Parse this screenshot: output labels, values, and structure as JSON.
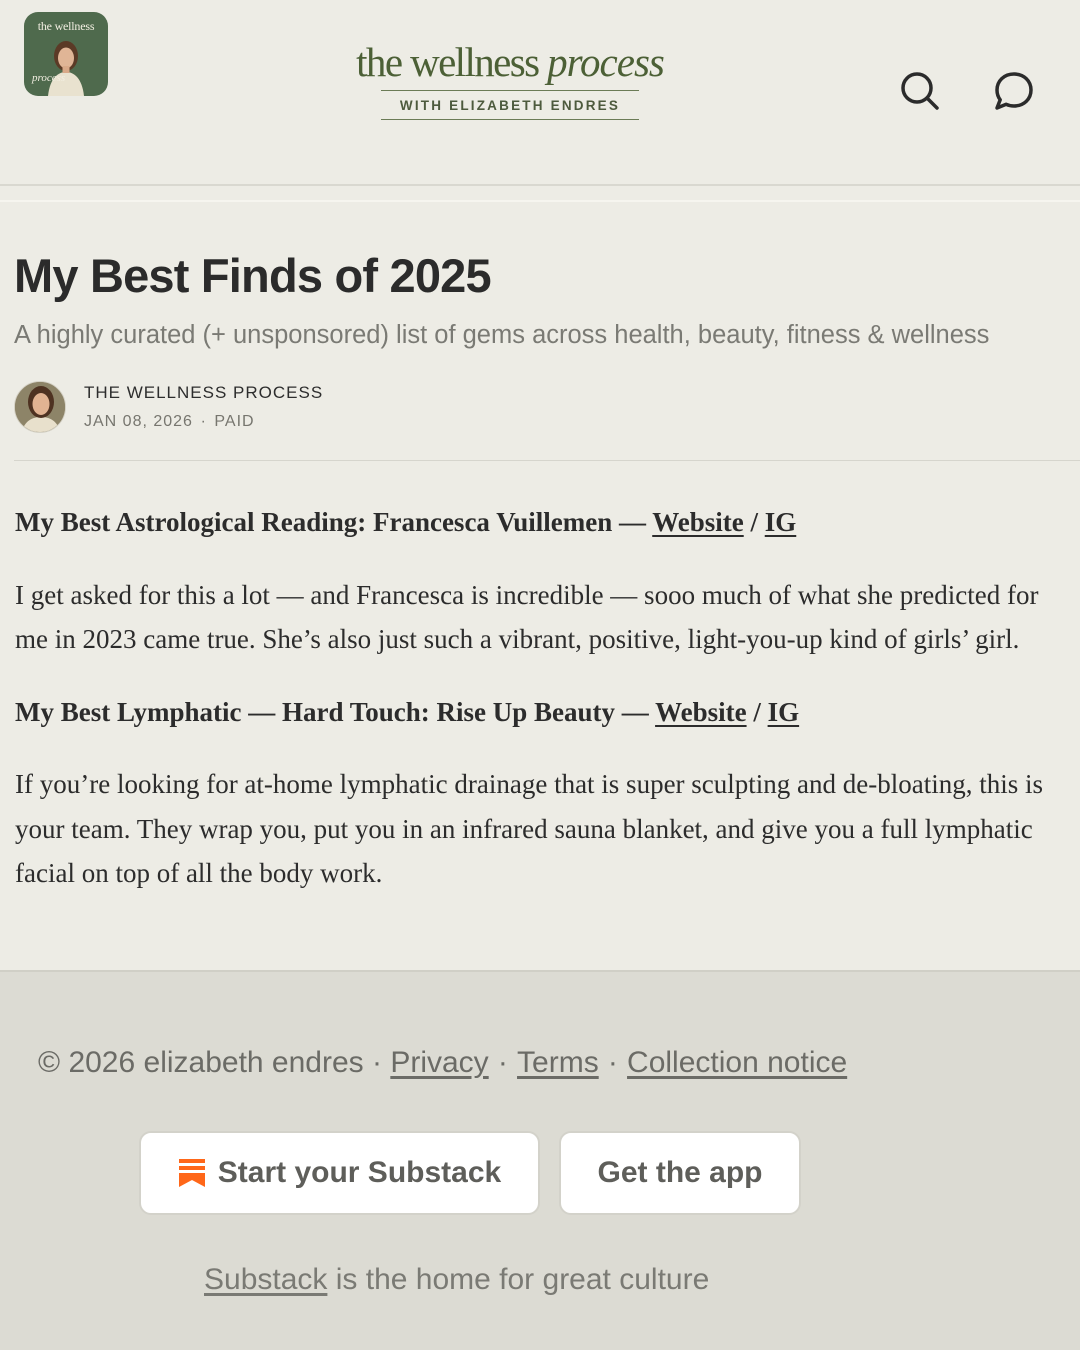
{
  "header": {
    "logo_top_text": "the wellness",
    "logo_bottom_text": "process",
    "wordmark_main": "the wellness ",
    "wordmark_italic": "process",
    "subline": "WITH ELIZABETH ENDRES",
    "icons": [
      "search-icon",
      "chat-bubble-icon"
    ]
  },
  "post": {
    "title": "My Best Finds of 2025",
    "subtitle": "A highly curated (+ unsponsored) list of gems across health, beauty, fitness & wellness",
    "author": "THE WELLNESS PROCESS",
    "date": "JAN 08, 2026",
    "separator": "∙",
    "access": "PAID"
  },
  "content": {
    "section1_heading": "My Best Astrological Reading: Francesca Vuillemen — ",
    "section1_link_website": "Website",
    "section1_slash": " / ",
    "section1_link_ig": "IG",
    "section1_body": "I get asked for this a lot — and Francesca is incredible — sooo much of what she predicted for me in 2023 came true. She’s also just such a vibrant, positive, light-you-up kind of girls’ girl.",
    "section2_heading": "My Best Lymphatic — Hard Touch: Rise Up Beauty — ",
    "section2_link_website": "Website",
    "section2_slash": " / ",
    "section2_link_ig": "IG",
    "section2_body": "If you’re looking for at-home lymphatic drainage that is super sculpting and de-bloating, this is your team. They wrap you, put you in an infrared sauna blanket, and give you a full lymphatic facial on top of all the body work."
  },
  "footer": {
    "copyright": "© 2026 elizabeth endres · ",
    "privacy": "Privacy",
    "dot": "∙",
    "terms": "Terms",
    "collection": "Collection notice",
    "start_button": "Start your Substack",
    "app_button": "Get the app",
    "tagline_link": "Substack",
    "tagline_rest": " is the home for great culture"
  },
  "colors": {
    "page_bg": "#edece5",
    "footer_bg": "#dcdbd3",
    "brand_green": "#4c6036",
    "substack_orange": "#ff6719"
  }
}
